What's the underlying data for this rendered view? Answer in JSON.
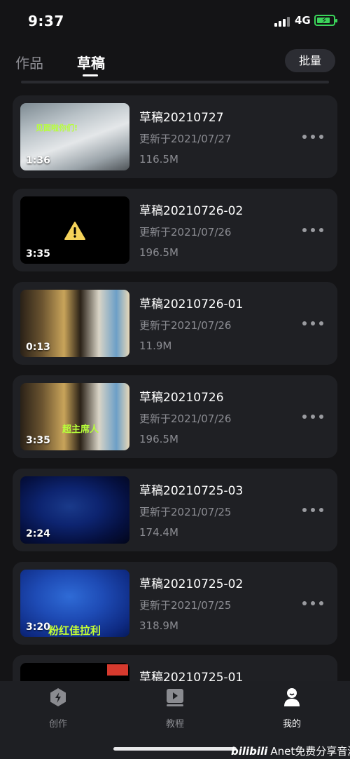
{
  "status_bar": {
    "time": "9:37",
    "network": "4G"
  },
  "tabs": [
    {
      "label": "作品"
    },
    {
      "label": "草稿"
    }
  ],
  "batch_label": "批量",
  "drafts": [
    {
      "title": "草稿20210727",
      "date": "更新于2021/07/27",
      "size": "116.5M",
      "duration": "1:36",
      "thumb_text": "见面啦你们!"
    },
    {
      "title": "草稿20210726-02",
      "date": "更新于2021/07/26",
      "size": "196.5M",
      "duration": "3:35"
    },
    {
      "title": "草稿20210726-01",
      "date": "更新于2021/07/26",
      "size": "11.9M",
      "duration": "0:13"
    },
    {
      "title": "草稿20210726",
      "date": "更新于2021/07/26",
      "size": "196.5M",
      "duration": "3:35",
      "thumb_text": "超主席人"
    },
    {
      "title": "草稿20210725-03",
      "date": "更新于2021/07/25",
      "size": "174.4M",
      "duration": "2:24"
    },
    {
      "title": "草稿20210725-02",
      "date": "更新于2021/07/25",
      "size": "318.9M",
      "duration": "3:20",
      "thumb_text": "粉红佳拉利"
    },
    {
      "title": "草稿20210725-01"
    }
  ],
  "bottom_nav": [
    {
      "label": "创作",
      "icon": "create-icon"
    },
    {
      "label": "教程",
      "icon": "tutorial-icon"
    },
    {
      "label": "我的",
      "icon": "profile-icon"
    }
  ],
  "watermark": {
    "brand": "bilibili",
    "text": "Anet免费分享音源"
  },
  "colors": {
    "background": "#141416",
    "card": "#1f2024",
    "battery": "#3bd45a",
    "accent_text": "#b7ff3a"
  }
}
